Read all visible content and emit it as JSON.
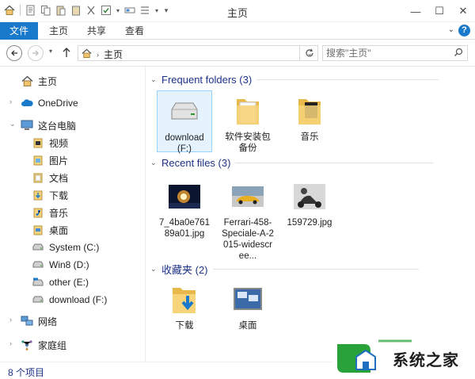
{
  "window": {
    "title": "主页",
    "minimize": "—",
    "maximize": "☐",
    "close": "✕"
  },
  "quick_access_toolbar": {
    "icons": [
      "home-icon",
      "properties-icon",
      "copy-icon",
      "paste-icon",
      "clipboard-icon",
      "cut-icon",
      "check-icon",
      "rename-icon",
      "layout-icon",
      "customize-dropdown-icon"
    ]
  },
  "ribbon": {
    "tabs": [
      {
        "label": "文件"
      },
      {
        "label": "主页"
      },
      {
        "label": "共享"
      },
      {
        "label": "查看"
      }
    ],
    "help": "?",
    "expand": "⌄"
  },
  "address_bar": {
    "crumb": "主页",
    "search_placeholder": "搜索\"主页\""
  },
  "nav_pane": {
    "items": [
      {
        "label": "主页",
        "icon": "home-icon"
      },
      {
        "label": "OneDrive",
        "icon": "cloud-icon"
      },
      {
        "label": "这台电脑",
        "icon": "computer-icon"
      },
      {
        "label": "视频",
        "icon": "video-folder-icon"
      },
      {
        "label": "图片",
        "icon": "pictures-folder-icon"
      },
      {
        "label": "文档",
        "icon": "documents-folder-icon"
      },
      {
        "label": "下载",
        "icon": "downloads-folder-icon"
      },
      {
        "label": "音乐",
        "icon": "music-folder-icon"
      },
      {
        "label": "桌面",
        "icon": "desktop-folder-icon"
      },
      {
        "label": "System (C:)",
        "icon": "drive-icon"
      },
      {
        "label": "Win8 (D:)",
        "icon": "drive-icon"
      },
      {
        "label": "other (E:)",
        "icon": "drive-icon"
      },
      {
        "label": "download (F:)",
        "icon": "drive-icon"
      },
      {
        "label": "网络",
        "icon": "network-icon"
      },
      {
        "label": "家庭组",
        "icon": "homegroup-icon"
      }
    ]
  },
  "content": {
    "groups": [
      {
        "title": "Frequent folders (3)",
        "items": [
          {
            "label": "download (F:)",
            "icon": "drive-icon",
            "selected": true
          },
          {
            "label": "软件安装包备份",
            "icon": "folder-icon",
            "selected": false
          },
          {
            "label": "音乐",
            "icon": "folder-icon",
            "selected": false
          }
        ]
      },
      {
        "title": "Recent files (3)",
        "items": [
          {
            "label": "7_4ba0e76189a01.jpg",
            "icon": "image-thumbnail-icon",
            "selected": false
          },
          {
            "label": "Ferrari-458-Speciale-A-2015-widescree...",
            "icon": "image-thumbnail-icon",
            "selected": false
          },
          {
            "label": "159729.jpg",
            "icon": "image-thumbnail-icon",
            "selected": false
          }
        ]
      },
      {
        "title": "收藏夹 (2)",
        "items": [
          {
            "label": "下载",
            "icon": "downloads-folder-icon",
            "selected": false
          },
          {
            "label": "桌面",
            "icon": "desktop-icon",
            "selected": false
          }
        ]
      }
    ]
  },
  "status_bar": {
    "item_count": "8 个项目"
  },
  "watermark": {
    "text": "系统之家"
  },
  "colors": {
    "accent": "#1979ca",
    "group_title": "#1e3287",
    "selection_bg": "#e5f3ff",
    "selection_border": "#99d1ff"
  }
}
